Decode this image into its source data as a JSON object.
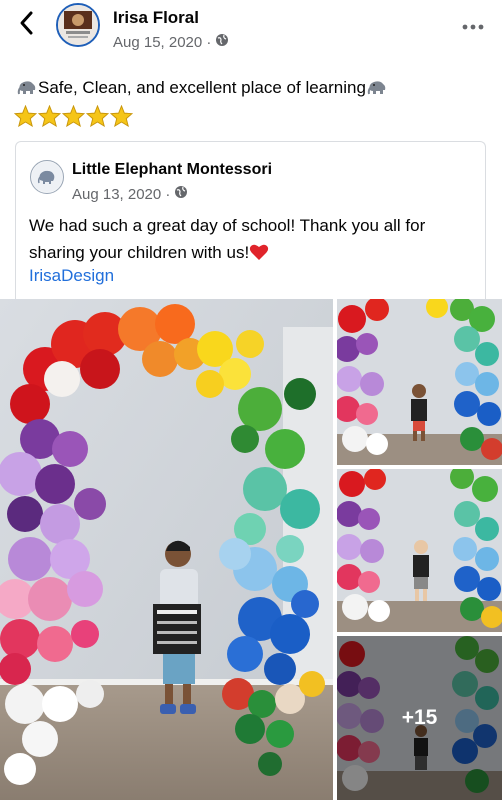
{
  "post": {
    "author": "Irisa Floral",
    "date": "Aug 15, 2020 ·",
    "text": "Safe, Clean, and excellent place of learning",
    "star_count": 5,
    "back_icon": "chevron-left-icon",
    "more_icon": "more-horizontal-icon"
  },
  "shared": {
    "author": "Little Elephant Montessori",
    "date": "Aug 13, 2020 ·",
    "text": "We had such a great day of school! Thank you all for sharing your children with us!",
    "link": "IrisaDesign"
  },
  "photos": {
    "more_count": "+15"
  },
  "colors": {
    "link": "#216fdb",
    "meta": "#65676b",
    "avatar_ring": "#1f5fb8",
    "star": "#f5c518"
  }
}
